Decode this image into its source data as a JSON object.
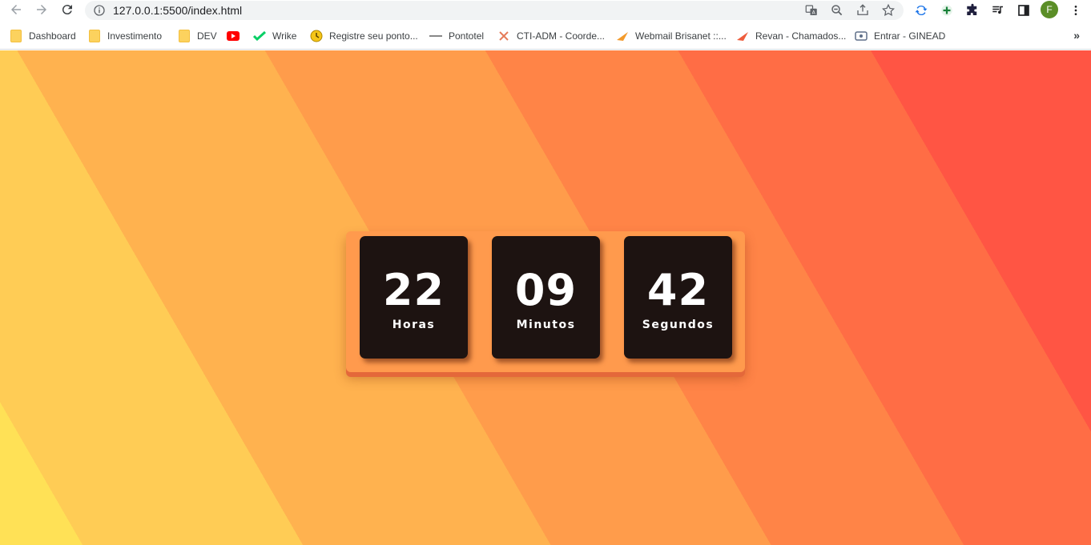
{
  "browser": {
    "url": "127.0.0.1:5500/index.html",
    "profile_initial": "F",
    "bookmarks": [
      {
        "label": "Dashboard",
        "icon": "folder-icon"
      },
      {
        "label": "Investimento",
        "icon": "folder-icon"
      },
      {
        "label": "DEV",
        "icon": "folder-icon"
      },
      {
        "label": "",
        "icon": "youtube-icon"
      },
      {
        "label": "Wrike",
        "icon": "wrike-icon"
      },
      {
        "label": "Registre seu ponto...",
        "icon": "clock-icon"
      },
      {
        "label": "Pontotel",
        "icon": "pontotel-icon"
      },
      {
        "label": "CTI-ADM - Coorde...",
        "icon": "cti-icon"
      },
      {
        "label": "Webmail Brisanet ::...",
        "icon": "webmail-icon"
      },
      {
        "label": "Revan - Chamados...",
        "icon": "revan-icon"
      },
      {
        "label": "Entrar - GINEAD",
        "icon": "ginead-icon"
      }
    ],
    "more_bookmarks": "»"
  },
  "clock": {
    "hours": {
      "value": "22",
      "label": "Horas"
    },
    "minutes": {
      "value": "09",
      "label": "Minutos"
    },
    "seconds": {
      "value": "42",
      "label": "Segundos"
    }
  },
  "colors": {
    "card_background": "#1d1311",
    "board_background": "#ff9a4d",
    "gradient_stops": [
      "#ffe156",
      "#ffcc55",
      "#ffb24f",
      "#ff9c4b",
      "#ff8447",
      "#ff6d45",
      "#ff5544"
    ]
  }
}
